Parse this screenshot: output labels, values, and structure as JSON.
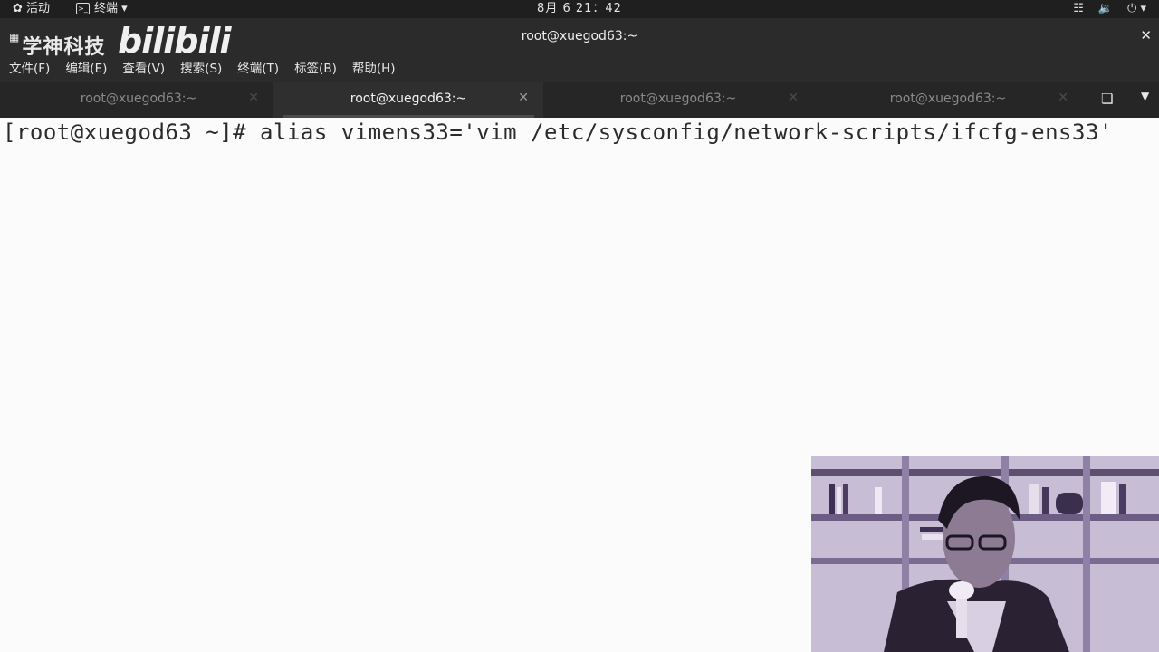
{
  "topbar": {
    "activities": "活动",
    "app_menu": "终端",
    "clock": "8月 6 21：42"
  },
  "window": {
    "brand": "学神科技",
    "brand_logo": "bilibili",
    "title": "root@xuegod63:~"
  },
  "menu": {
    "file": "文件(F)",
    "edit": "编辑(E)",
    "view": "查看(V)",
    "search": "搜索(S)",
    "terminal": "终端(T)",
    "tabs": "标签(B)",
    "help": "帮助(H)"
  },
  "tabs": [
    {
      "label": "root@xuegod63:~",
      "active": false
    },
    {
      "label": "root@xuegod63:~",
      "active": true
    },
    {
      "label": "root@xuegod63:~",
      "active": false
    },
    {
      "label": "root@xuegod63:~",
      "active": false
    }
  ],
  "terminal": {
    "prompt": "[root@xuegod63 ~]# ",
    "command": "alias vimens33='vim /etc/sysconfig/network-scripts/ifcfg-ens33'"
  },
  "icons": {
    "activities": "activities-icon",
    "terminal_app": "terminal-icon",
    "network": "network-icon",
    "volume": "volume-icon",
    "power": "power-icon",
    "new_tab": "new-tab-icon",
    "tab_menu": "chevron-down-icon",
    "close": "close-icon"
  },
  "colors": {
    "topbar_bg": "#1f1f1f",
    "titlebar_bg": "#2b2b2b",
    "terminal_bg": "#fcfbfb",
    "terminal_fg": "#2b2b2b"
  }
}
